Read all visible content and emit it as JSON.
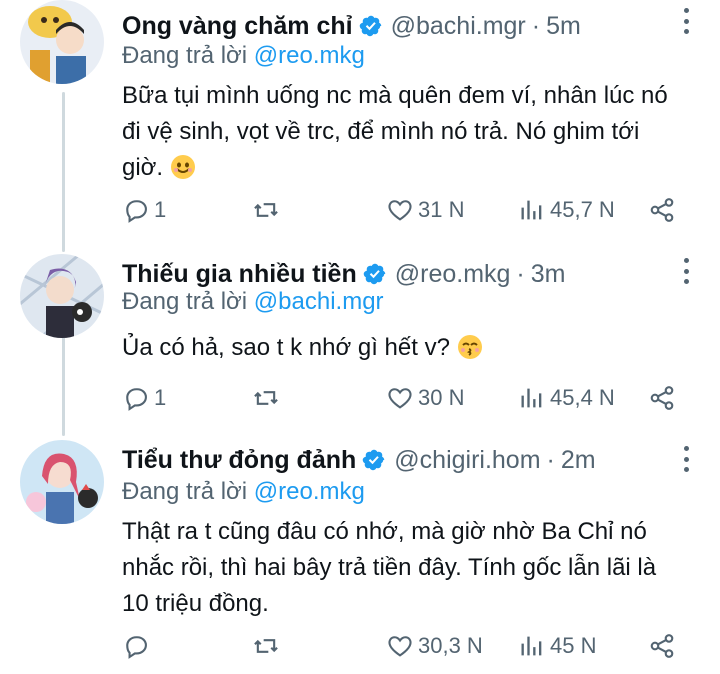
{
  "tweets": [
    {
      "name": "Ong vàng chăm chỉ",
      "handle": "@bachi.mgr",
      "time": "5m",
      "replying_prefix": "Đang trả lời ",
      "replying_to": "@reo.mkg",
      "text": "Bữa tụi mình uống nc mà quên đem ví, nhân lúc nó đi vệ sinh, vọt về trc, để mình nó trả. Nó ghim tới giờ. ",
      "emoji": "smiling-face-emoji",
      "replies": "1",
      "retweets": "",
      "likes": "31 N",
      "views": "45,7 N",
      "avatar_color": "#f2c94c"
    },
    {
      "name": "Thiếu gia nhiều tiền",
      "handle": "@reo.mkg",
      "time": "3m",
      "replying_prefix": "Đang trả lời ",
      "replying_to": "@bachi.mgr",
      "text": "Ủa có hả, sao t k nhớ gì hết v? ",
      "emoji": "kissing-face-emoji",
      "replies": "1",
      "retweets": "",
      "likes": "30 N",
      "views": "45,4 N",
      "avatar_color": "#7b5ea7"
    },
    {
      "name": "Tiểu thư đỏng đảnh",
      "handle": "@chigiri.hom",
      "time": "2m",
      "replying_prefix": "Đang trả lời ",
      "replying_to": "@reo.mkg",
      "text": "Thật ra t cũng đâu có nhớ, mà giờ nhờ Ba Chỉ nó nhắc rồi, thì hai bây trả tiền đây. Tính gốc lẫn lãi là 10 triệu đồng.",
      "emoji": "",
      "replies": "",
      "retweets": "",
      "likes": "30,3 N",
      "views": "45 N",
      "avatar_color": "#d9536f"
    }
  ],
  "colors": {
    "verified": "#1d9bf0",
    "mention": "#1d9bf0",
    "muted": "#536471"
  }
}
